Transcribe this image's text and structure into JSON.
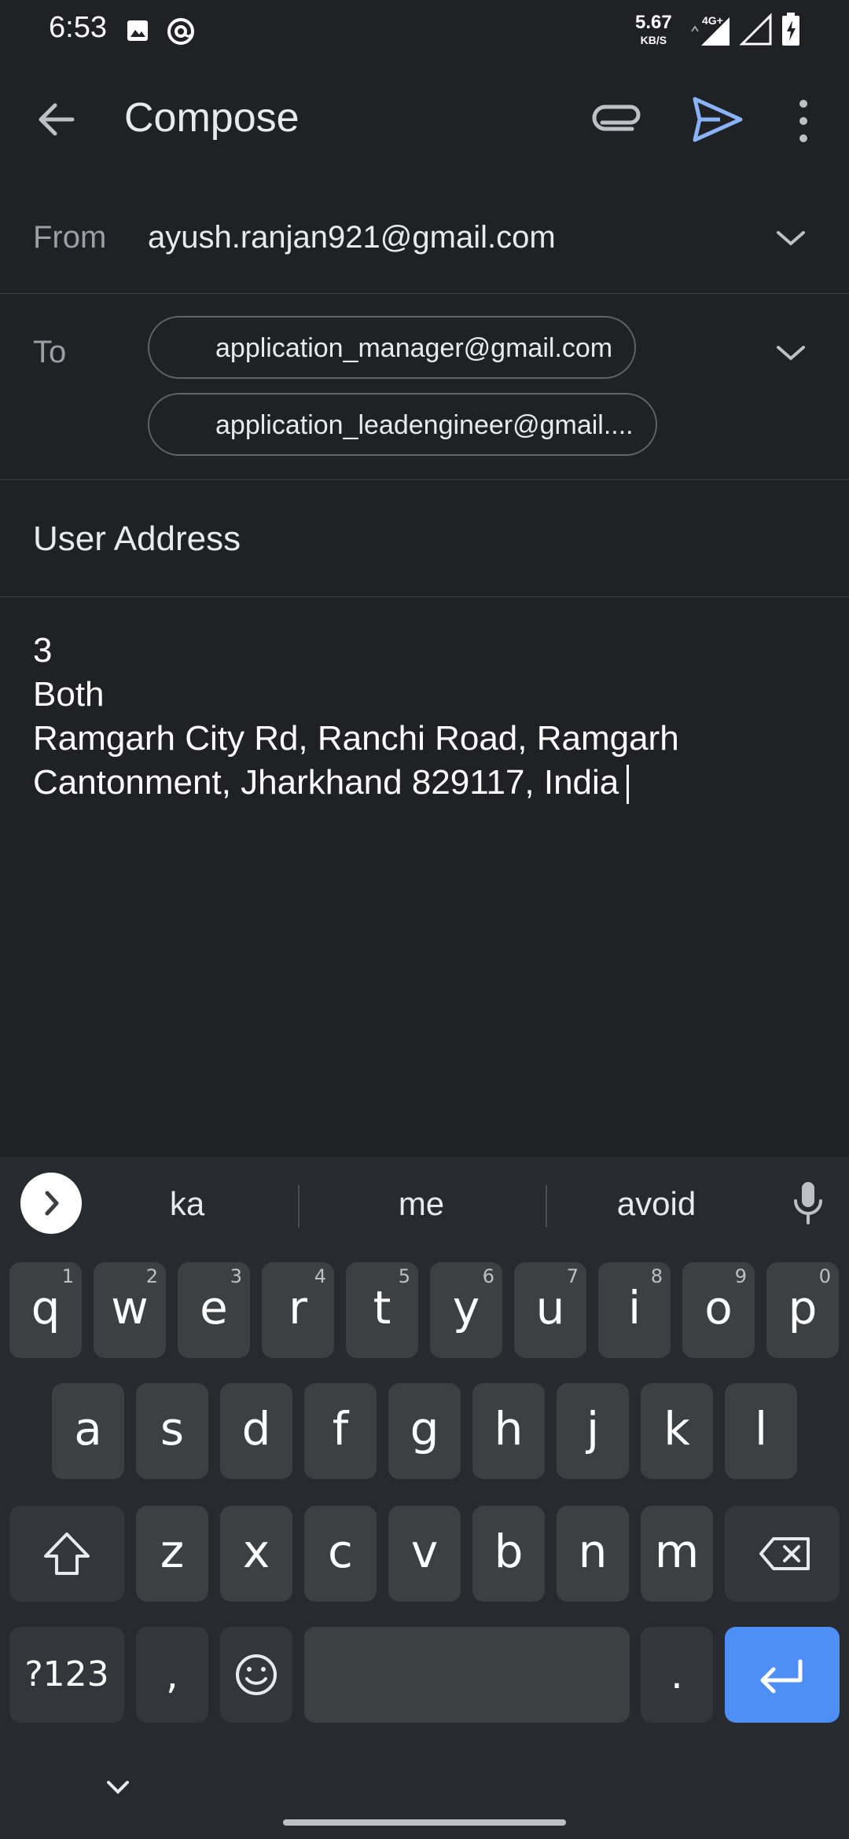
{
  "status_bar": {
    "time": "6:53",
    "speed_value": "5.67",
    "speed_unit": "KB/S",
    "network_type": "4G+"
  },
  "app_bar": {
    "title": "Compose"
  },
  "from": {
    "label": "From",
    "value": "ayush.ranjan921@gmail.com"
  },
  "to": {
    "label": "To",
    "recipients": [
      "application_manager@gmail.com",
      "application_leadengineer@gmail...."
    ]
  },
  "subject": "User Address",
  "body_lines": [
    "3",
    "Both",
    "Ramgarh City Rd, Ranchi Road, Ramgarh",
    "Cantonment, Jharkhand 829117, India"
  ],
  "keyboard": {
    "suggestions": [
      "ka",
      "me",
      "avoid"
    ],
    "row1": [
      {
        "key": "q",
        "hint": "1"
      },
      {
        "key": "w",
        "hint": "2"
      },
      {
        "key": "e",
        "hint": "3"
      },
      {
        "key": "r",
        "hint": "4"
      },
      {
        "key": "t",
        "hint": "5"
      },
      {
        "key": "y",
        "hint": "6"
      },
      {
        "key": "u",
        "hint": "7"
      },
      {
        "key": "i",
        "hint": "8"
      },
      {
        "key": "o",
        "hint": "9"
      },
      {
        "key": "p",
        "hint": "0"
      }
    ],
    "row2": [
      "a",
      "s",
      "d",
      "f",
      "g",
      "h",
      "j",
      "k",
      "l"
    ],
    "row3": [
      "z",
      "x",
      "c",
      "v",
      "b",
      "n",
      "m"
    ],
    "symbols_label": "?123",
    "comma": ",",
    "period": "."
  },
  "colors": {
    "background": "#202124",
    "accent": "#8ab4f8",
    "enter_key": "#4f8ef5"
  }
}
